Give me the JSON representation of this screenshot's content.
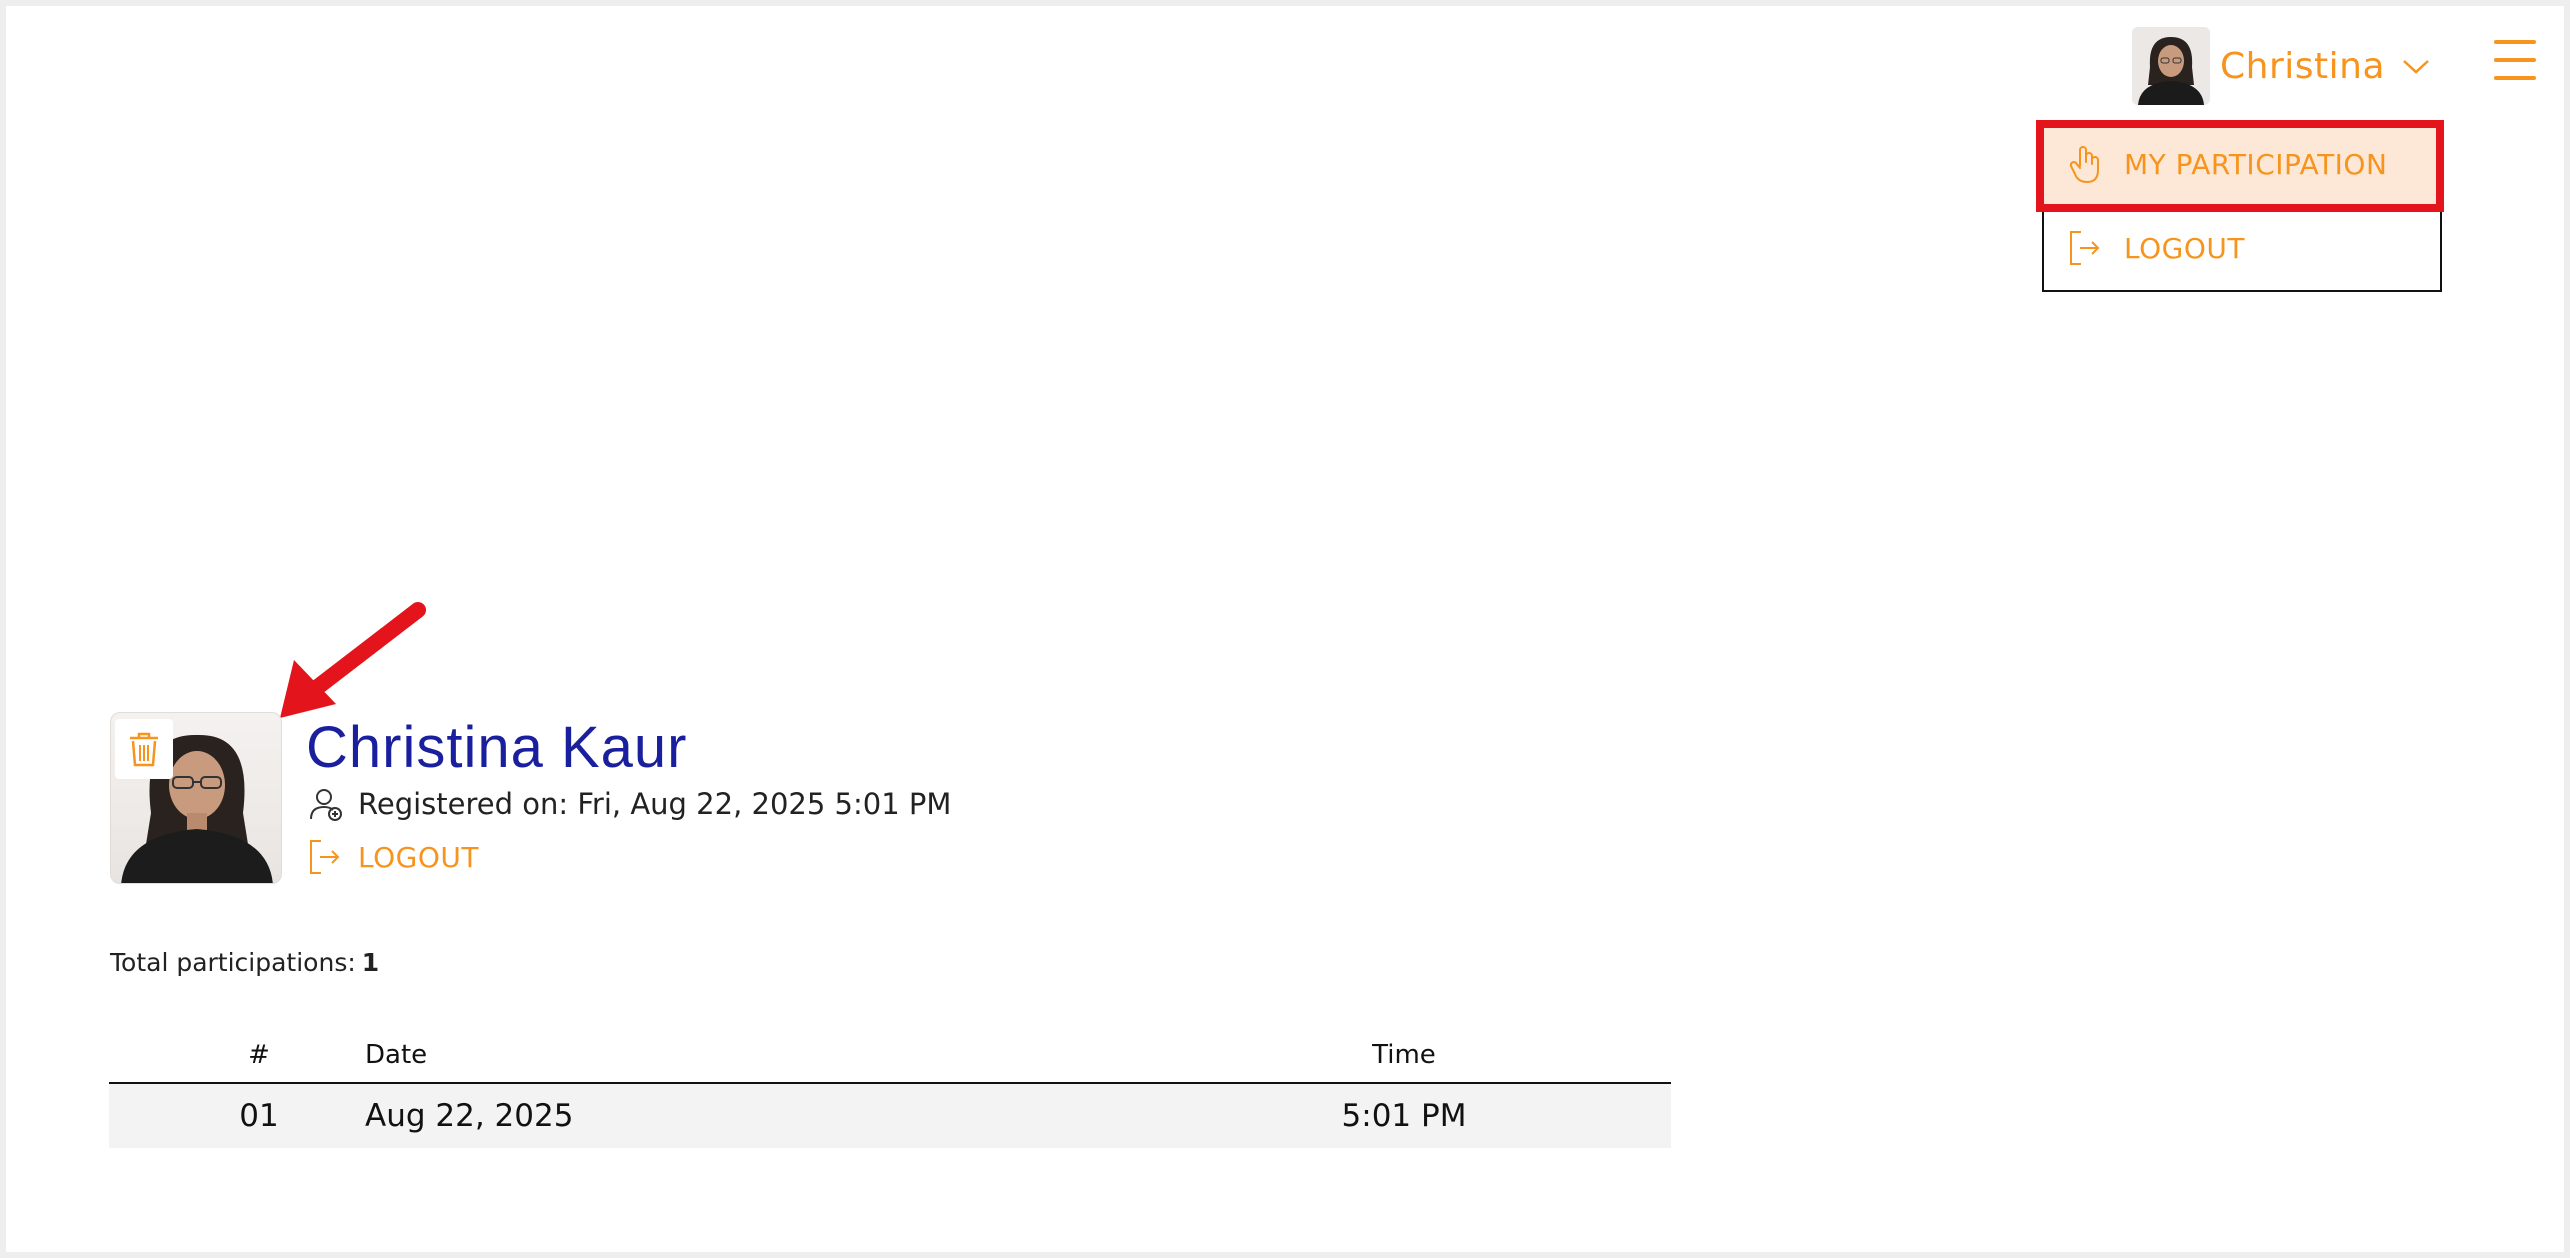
{
  "header": {
    "user_name": "Christina",
    "menu_icon": "hamburger-menu-icon"
  },
  "dropdown": {
    "items": [
      {
        "label": "MY PARTICIPATION",
        "icon": "hand-raised-icon",
        "active": true
      },
      {
        "label": "LOGOUT",
        "icon": "logout-icon",
        "active": false
      }
    ]
  },
  "profile": {
    "name": "Christina Kaur",
    "registered_text": "Registered on: Fri, Aug 22, 2025 5:01 PM",
    "logout_label": "LOGOUT"
  },
  "summary": {
    "total_label": "Total participations:",
    "total_value": "1"
  },
  "table": {
    "headers": [
      "#",
      "Date",
      "Time"
    ],
    "rows": [
      {
        "num": "01",
        "date": "Aug 22, 2025",
        "time": "5:01 PM"
      }
    ]
  },
  "colors": {
    "accent": "#f7941d",
    "name": "#1a1f9e",
    "highlight": "#e3141b",
    "active_bg": "#fde7d6"
  }
}
